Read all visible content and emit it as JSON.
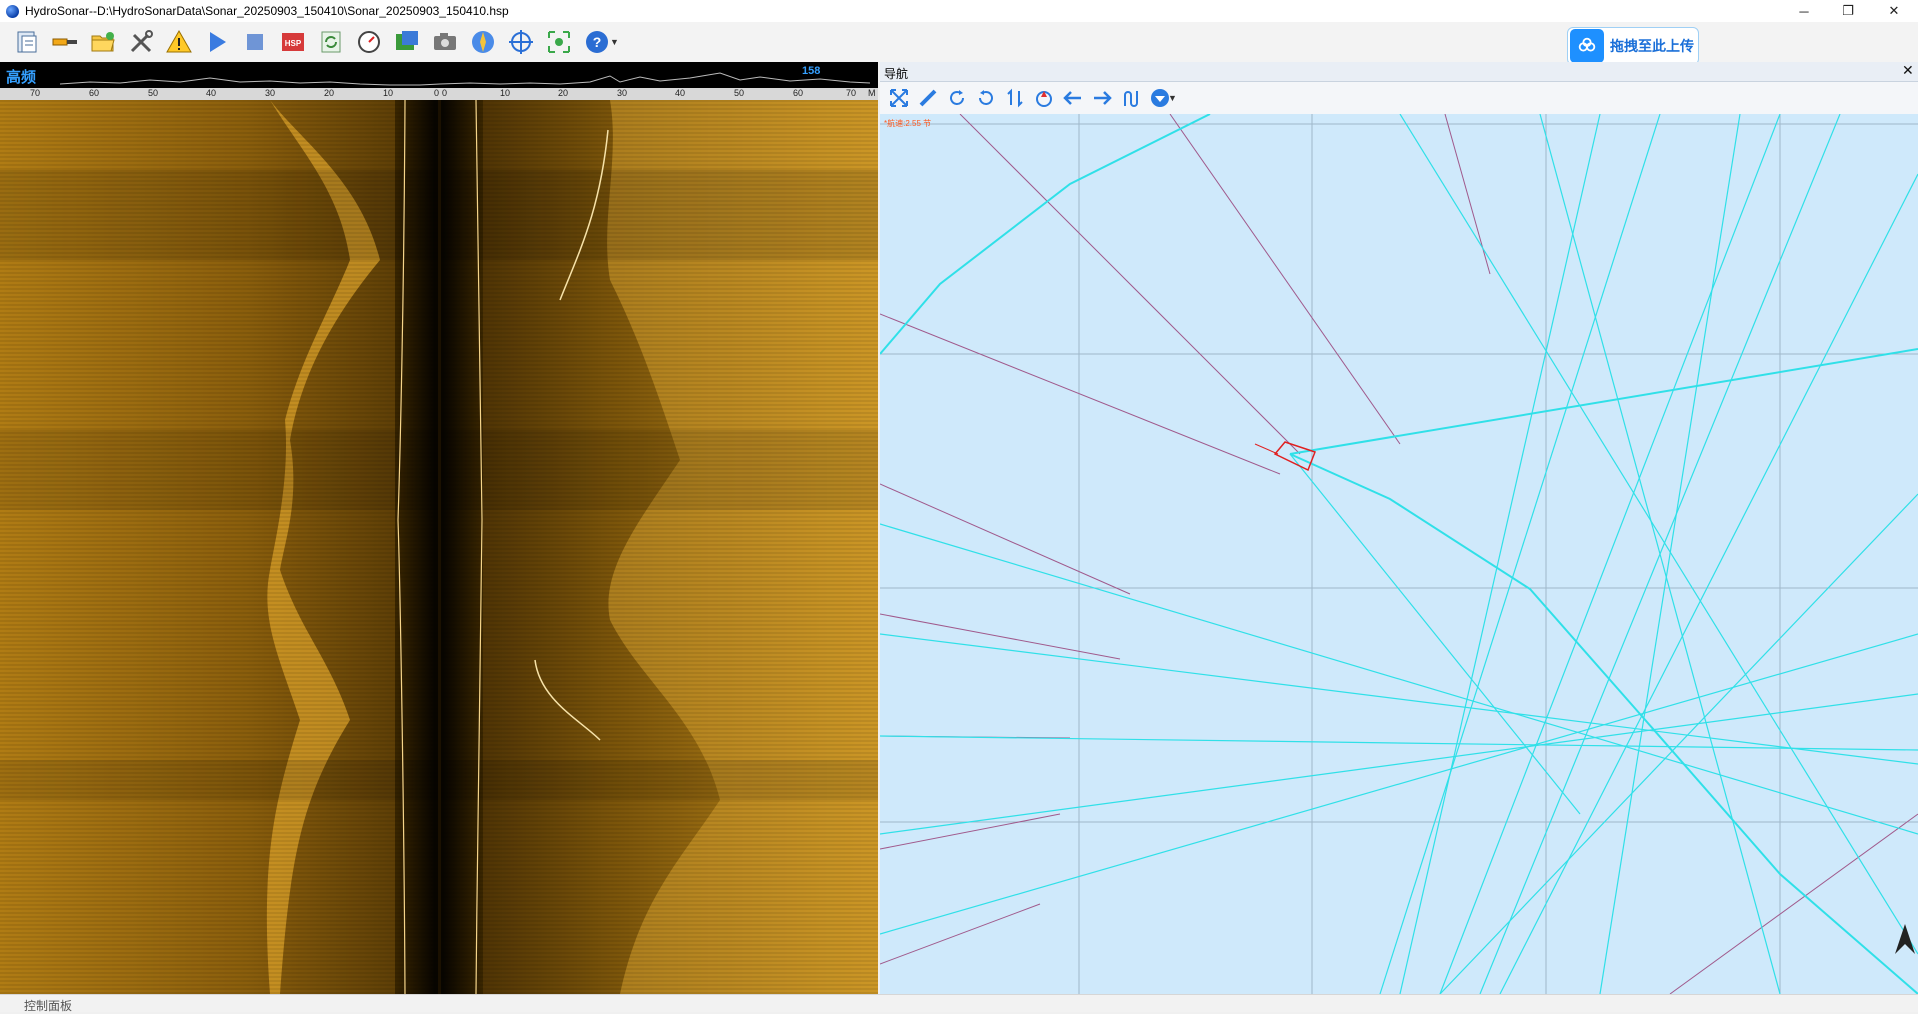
{
  "window": {
    "title": "HydroSonar--D:\\HydroSonarData\\Sonar_20250903_150410\\Sonar_20250903_150410.hsp",
    "minimize_icon": "minimize-icon",
    "maximize_icon": "restore-icon",
    "close_icon": "close-icon"
  },
  "toolbar": {
    "buttons": [
      {
        "icon": "open-project-icon"
      },
      {
        "icon": "connect-sensor-icon"
      },
      {
        "icon": "folder-open-icon"
      },
      {
        "icon": "tools-icon"
      },
      {
        "icon": "warning-icon"
      },
      {
        "icon": "play-icon"
      },
      {
        "icon": "stop-icon"
      },
      {
        "icon": "hsp-file-icon"
      },
      {
        "icon": "refresh-icon"
      },
      {
        "icon": "gauge-icon"
      },
      {
        "icon": "export-image-icon"
      },
      {
        "icon": "camera-icon"
      },
      {
        "icon": "compass-icon"
      },
      {
        "icon": "crosshair-icon"
      },
      {
        "icon": "target-icon"
      },
      {
        "icon": "help-icon"
      }
    ],
    "upload_label": "拖拽至此上传",
    "colors": {
      "accent": "#1e90ff"
    }
  },
  "sonar": {
    "frequency_label": "高频",
    "ping_number": "158",
    "ruler_ticks": [
      "70",
      "60",
      "50",
      "40",
      "30",
      "20",
      "10",
      "0",
      "0",
      "10",
      "20",
      "30",
      "40",
      "50",
      "60",
      "70",
      "M"
    ],
    "colors": {
      "dark": "#3a2500",
      "bright": "#f0b030",
      "label": "#35a0ff"
    }
  },
  "navigation": {
    "title": "导航",
    "close_icon": "close-icon",
    "tools": [
      {
        "icon": "fit-extent-icon"
      },
      {
        "icon": "measure-icon"
      },
      {
        "icon": "rotate-cw-icon"
      },
      {
        "icon": "rotate-ccw-icon"
      },
      {
        "icon": "north-up-icon"
      },
      {
        "icon": "heading-icon"
      },
      {
        "icon": "arrow-left-icon"
      },
      {
        "icon": "arrow-right-icon"
      },
      {
        "icon": "u-turn-icon"
      },
      {
        "icon": "layers-dropdown-icon"
      }
    ],
    "scale_note": "*航速:2.55 节",
    "colors": {
      "water": "#cfe9fb",
      "track": "#30e0e8",
      "line": "#a05a8c",
      "vessel": "#e02020"
    }
  },
  "status": {
    "panel_tab": "控制面板"
  }
}
